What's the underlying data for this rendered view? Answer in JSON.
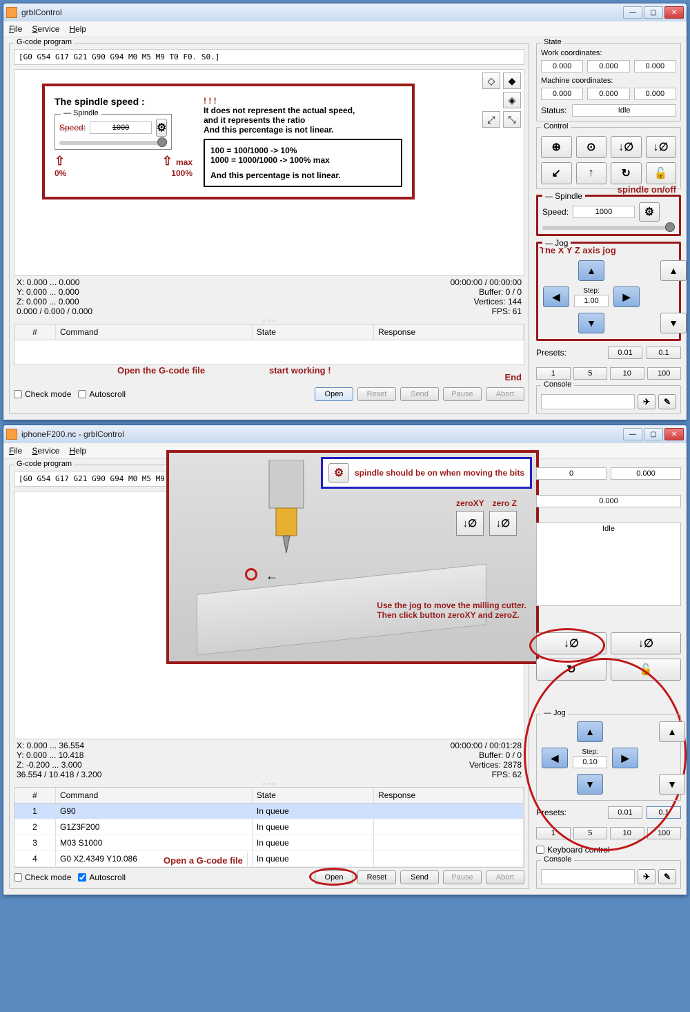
{
  "win1": {
    "title": "grblControl",
    "menus": [
      "File",
      "Service",
      "Help"
    ],
    "gcode_group": "G-code program",
    "gcode_line": "[G0 G54 G17 G21 G90 G94 M0 M5 M9 T0 F0. S0.]",
    "status_left": [
      "X: 0.000 ... 0.000",
      "Y: 0.000 ... 0.000",
      "Z: 0.000 ... 0.000",
      "0.000 / 0.000 / 0.000"
    ],
    "status_right": [
      "00:00:00 / 00:00:00",
      "Buffer: 0 / 0",
      "Vertices: 144",
      "FPS: 61"
    ],
    "table_headers": [
      "#",
      "Command",
      "State",
      "Response"
    ],
    "check_mode": "Check mode",
    "autoscroll": "Autoscroll",
    "buttons": {
      "open": "Open",
      "reset": "Reset",
      "send": "Send",
      "pause": "Pause",
      "abort": "Abort"
    },
    "annotations": {
      "open": "Open the G-code file",
      "send": "start working !",
      "abort": "End",
      "overlay_title": "The spindle speed :",
      "bang": "!  !  !",
      "line1": "It does not represent the actual speed,",
      "line2": "and it represents the ratio",
      "line3": "And this percentage is not linear.",
      "ratio1": "100   =   100/1000  -> 10%",
      "ratio2": "1000  =  1000/1000  -> 100% max",
      "ratio3": "And this percentage is not linear.",
      "zero_pct": "0%",
      "hundred": "100%",
      "max": "max",
      "spindle_onoff": "spindle on/off",
      "jog_label": "The X Y Z axis jog"
    }
  },
  "right1": {
    "state": "State",
    "work_label": "Work coordinates:",
    "work": [
      "0.000",
      "0.000",
      "0.000"
    ],
    "mach_label": "Machine coordinates:",
    "mach": [
      "0.000",
      "0.000",
      "0.000"
    ],
    "status_lbl": "Status:",
    "status_val": "Idle",
    "control": "Control",
    "spindle": "Spindle",
    "speed_lbl": "Speed:",
    "speed_val": "1000",
    "jog": "Jog",
    "step_lbl": "Step:",
    "step_val": "1.00",
    "presets_lbl": "Presets:",
    "presets_top": [
      "0.01",
      "0.1"
    ],
    "presets_bot": [
      "1",
      "5",
      "10",
      "100"
    ],
    "console": "Console"
  },
  "win2": {
    "title": "iphoneF200.nc - grblControl",
    "gcode_line": "[G0 G54 G17 G21 G90 G94 M0 M5 M9 T0 F0. S0.]",
    "status_left": [
      "X: 0.000 ... 36.554",
      "Y: 0.000 ... 10.418",
      "Z: -0.200 ... 3.000",
      "36.554 / 10.418 / 3.200"
    ],
    "status_right": [
      "00:00:00 / 00:01:28",
      "Buffer: 0 / 0",
      "Vertices: 2878",
      "FPS: 62"
    ],
    "rows": [
      {
        "n": "1",
        "cmd": "G90",
        "state": "In queue",
        "resp": ""
      },
      {
        "n": "2",
        "cmd": "G1Z3F200",
        "state": "In queue",
        "resp": ""
      },
      {
        "n": "3",
        "cmd": "M03 S1000",
        "state": "In queue",
        "resp": ""
      },
      {
        "n": "4",
        "cmd": "G0 X2.4349 Y10.086",
        "state": "In queue",
        "resp": ""
      }
    ],
    "autoscroll_checked": true,
    "annotations": {
      "open": "Open a G-code file",
      "tip": "spindle should be on when moving the bits",
      "zeroxy": "zeroXY",
      "zeroz": "zero Z",
      "instr1": "Use the jog to move the milling cutter.",
      "instr2": "Then click button zeroXY and zeroZ."
    }
  },
  "right2": {
    "work": [
      "",
      "",
      "0.000"
    ],
    "mach": [
      "",
      "",
      "0.000"
    ],
    "status_val": "Idle",
    "step_val": "0.10",
    "presets_top": [
      "0.01",
      "0.1"
    ],
    "presets_bot": [
      "1",
      "5",
      "10",
      "100"
    ],
    "kbd": "Keyboard control",
    "console": "Console"
  }
}
